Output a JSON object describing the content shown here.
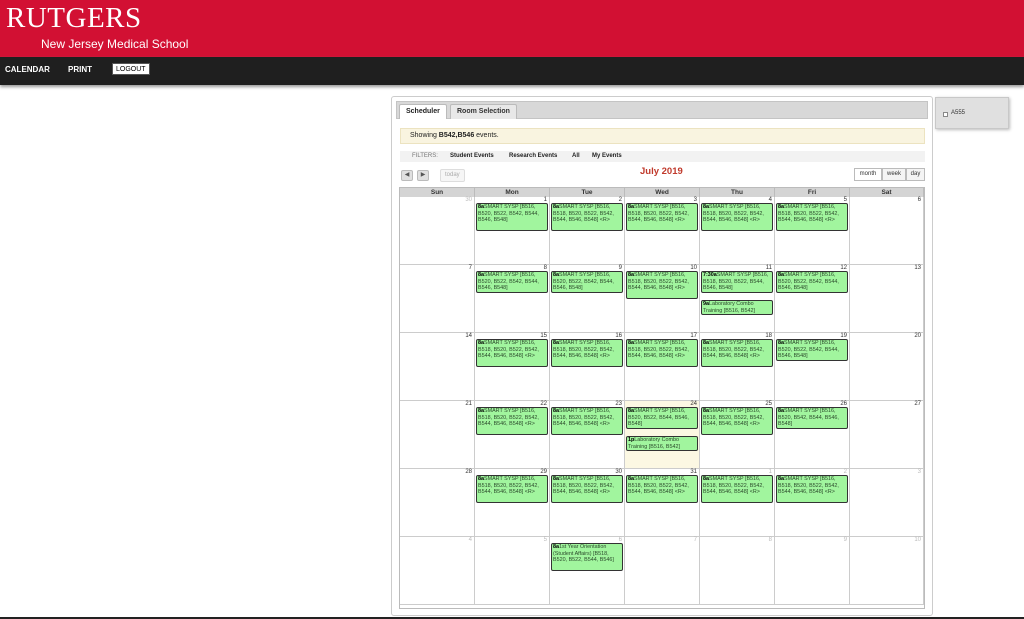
{
  "header": {
    "logo_main": "RUTGERS",
    "logo_sub": "New Jersey Medical School",
    "bg_color": "#d21033"
  },
  "nav": {
    "calendar": "CALENDAR",
    "print": "PRINT",
    "logout": "LOGOUT"
  },
  "tabs": [
    "Scheduler",
    "Room Selection"
  ],
  "notice": {
    "prefix": "Showing ",
    "rooms": "B542,B546",
    "suffix": " events."
  },
  "filters": {
    "label": "FILTERS:",
    "items": [
      "Student Events",
      "Research Events",
      "All",
      "My Events"
    ]
  },
  "toolbar": {
    "prev_icon": "chevron-left-icon",
    "next_icon": "chevron-right-icon",
    "today": "today",
    "title": "July 2019",
    "views": [
      "month",
      "week",
      "day"
    ],
    "active_view": "month"
  },
  "weekdays": [
    "Sun",
    "Mon",
    "Tue",
    "Wed",
    "Thu",
    "Fri",
    "Sat"
  ],
  "weeks": [
    [
      {
        "d": "30",
        "o": true
      },
      {
        "d": "1"
      },
      {
        "d": "2"
      },
      {
        "d": "3"
      },
      {
        "d": "4"
      },
      {
        "d": "5"
      },
      {
        "d": "6"
      }
    ],
    [
      {
        "d": "7"
      },
      {
        "d": "8"
      },
      {
        "d": "9"
      },
      {
        "d": "10"
      },
      {
        "d": "11"
      },
      {
        "d": "12"
      },
      {
        "d": "13"
      }
    ],
    [
      {
        "d": "14"
      },
      {
        "d": "15"
      },
      {
        "d": "16"
      },
      {
        "d": "17"
      },
      {
        "d": "18"
      },
      {
        "d": "19"
      },
      {
        "d": "20"
      }
    ],
    [
      {
        "d": "21"
      },
      {
        "d": "22"
      },
      {
        "d": "23"
      },
      {
        "d": "24",
        "today": true
      },
      {
        "d": "25"
      },
      {
        "d": "26"
      },
      {
        "d": "27"
      }
    ],
    [
      {
        "d": "28"
      },
      {
        "d": "29"
      },
      {
        "d": "30"
      },
      {
        "d": "31"
      },
      {
        "d": "1",
        "o": true
      },
      {
        "d": "2",
        "o": true
      },
      {
        "d": "3",
        "o": true
      }
    ],
    [
      {
        "d": "4",
        "o": true
      },
      {
        "d": "5",
        "o": true
      },
      {
        "d": "6",
        "o": true
      },
      {
        "d": "7",
        "o": true
      },
      {
        "d": "8",
        "o": true
      },
      {
        "d": "9",
        "o": true
      },
      {
        "d": "10",
        "o": true
      }
    ]
  ],
  "events": [
    {
      "w": 0,
      "c": 1,
      "slot": 0,
      "lines": 4,
      "time": "8a",
      "title": "SMART SYSP [B516, B520, B522, B542, B544, B546, B548]"
    },
    {
      "w": 0,
      "c": 2,
      "slot": 0,
      "lines": 4,
      "time": "8a",
      "title": "SMART SYSP [B516, B518, B520, B522, B542, B544, B546, B548] <R>"
    },
    {
      "w": 0,
      "c": 3,
      "slot": 0,
      "lines": 4,
      "time": "8a",
      "title": "SMART SYSP [B516, B518, B520, B522, B542, B544, B546, B548] <R>"
    },
    {
      "w": 0,
      "c": 4,
      "slot": 0,
      "lines": 4,
      "time": "8a",
      "title": "SMART SYSP [B516, B518, B520, B522, B542, B544, B546, B548] <R>"
    },
    {
      "w": 0,
      "c": 5,
      "slot": 0,
      "lines": 4,
      "time": "8a",
      "title": "SMART SYSP [B516, B518, B520, B522, B542, B544, B546, B548] <R>"
    },
    {
      "w": 1,
      "c": 1,
      "slot": 0,
      "lines": 3,
      "time": "8a",
      "title": "SMART SYSP [B516, B520, B522, B542, B544, B546, B548]"
    },
    {
      "w": 1,
      "c": 2,
      "slot": 0,
      "lines": 3,
      "time": "8a",
      "title": "SMART SYSP [B516, B520, B522, B542, B544, B546, B548]"
    },
    {
      "w": 1,
      "c": 3,
      "slot": 0,
      "lines": 4,
      "time": "8a",
      "title": "SMART SYSP [B516, B518, B520, B522, B542, B544, B546, B548] <R>"
    },
    {
      "w": 1,
      "c": 4,
      "slot": 0,
      "lines": 3,
      "time": "7:30a",
      "title": "SMART SYSP [B516, B518, B520, B522, B544, B546, B548]"
    },
    {
      "w": 1,
      "c": 4,
      "slot": 1,
      "lines": 2,
      "time": "9a",
      "title": "Laboratory Combo Training [B516, B542]"
    },
    {
      "w": 1,
      "c": 5,
      "slot": 0,
      "lines": 3,
      "time": "8a",
      "title": "SMART SYSP [B516, B520, B522, B542, B544, B546, B548]"
    },
    {
      "w": 2,
      "c": 1,
      "slot": 0,
      "lines": 4,
      "time": "8a",
      "title": "SMART SYSP [B516, B518, B520, B522, B542, B544, B546, B548] <R>"
    },
    {
      "w": 2,
      "c": 2,
      "slot": 0,
      "lines": 4,
      "time": "8a",
      "title": "SMART SYSP [B516, B518, B520, B522, B542, B544, B546, B548] <R>"
    },
    {
      "w": 2,
      "c": 3,
      "slot": 0,
      "lines": 4,
      "time": "8a",
      "title": "SMART SYSP [B516, B518, B520, B522, B542, B544, B546, B548] <R>"
    },
    {
      "w": 2,
      "c": 4,
      "slot": 0,
      "lines": 4,
      "time": "8a",
      "title": "SMART SYSP [B516, B518, B520, B522, B542, B544, B546, B548] <R>"
    },
    {
      "w": 2,
      "c": 5,
      "slot": 0,
      "lines": 3,
      "time": "8a",
      "title": "SMART SYSP [B516, B520, B522, B542, B544, B546, B548]"
    },
    {
      "w": 3,
      "c": 1,
      "slot": 0,
      "lines": 4,
      "time": "8a",
      "title": "SMART SYSP [B516, B518, B520, B522, B542, B544, B546, B548] <R>"
    },
    {
      "w": 3,
      "c": 2,
      "slot": 0,
      "lines": 4,
      "time": "8a",
      "title": "SMART SYSP [B516, B518, B520, B522, B542, B544, B546, B548] <R>"
    },
    {
      "w": 3,
      "c": 3,
      "slot": 0,
      "lines": 3,
      "time": "8a",
      "title": "SMART SYSP [B516, B520, B522, B544, B546, B548]"
    },
    {
      "w": 3,
      "c": 3,
      "slot": 1,
      "lines": 2,
      "time": "1p",
      "title": "Laboratory Combo Training [B516, B542]"
    },
    {
      "w": 3,
      "c": 4,
      "slot": 0,
      "lines": 4,
      "time": "8a",
      "title": "SMART SYSP [B516, B518, B520, B522, B542, B544, B546, B548] <R>"
    },
    {
      "w": 3,
      "c": 5,
      "slot": 0,
      "lines": 3,
      "time": "8a",
      "title": "SMART SYSP [B516, B520, B542, B544, B546, B548]"
    },
    {
      "w": 4,
      "c": 1,
      "slot": 0,
      "lines": 4,
      "time": "8a",
      "title": "SMART SYSP [B516, B518, B520, B522, B542, B544, B546, B548] <R>"
    },
    {
      "w": 4,
      "c": 2,
      "slot": 0,
      "lines": 4,
      "time": "8a",
      "title": "SMART SYSP [B516, B518, B520, B522, B542, B544, B546, B548] <R>"
    },
    {
      "w": 4,
      "c": 3,
      "slot": 0,
      "lines": 4,
      "time": "8a",
      "title": "SMART SYSP [B516, B518, B520, B522, B542, B544, B546, B548] <R>"
    },
    {
      "w": 4,
      "c": 4,
      "slot": 0,
      "lines": 4,
      "time": "8a",
      "title": "SMART SYSP [B516, B518, B520, B522, B542, B544, B546, B548] <R>"
    },
    {
      "w": 4,
      "c": 5,
      "slot": 0,
      "lines": 4,
      "time": "8a",
      "title": "SMART SYSP [B516, B518, B520, B522, B542, B544, B546, B548] <R>"
    },
    {
      "w": 5,
      "c": 2,
      "slot": 0,
      "lines": 4,
      "time": "8a",
      "title": "1st Year Orientation (Student Affairs) [B518, B520, B522, B544, B546]"
    }
  ],
  "room_list": [
    {
      "label": "A555",
      "checked": false
    }
  ],
  "colors": {
    "event_bg": "#a1f59e",
    "today_bg": "#fcf8e3",
    "title": "#c0392b"
  }
}
